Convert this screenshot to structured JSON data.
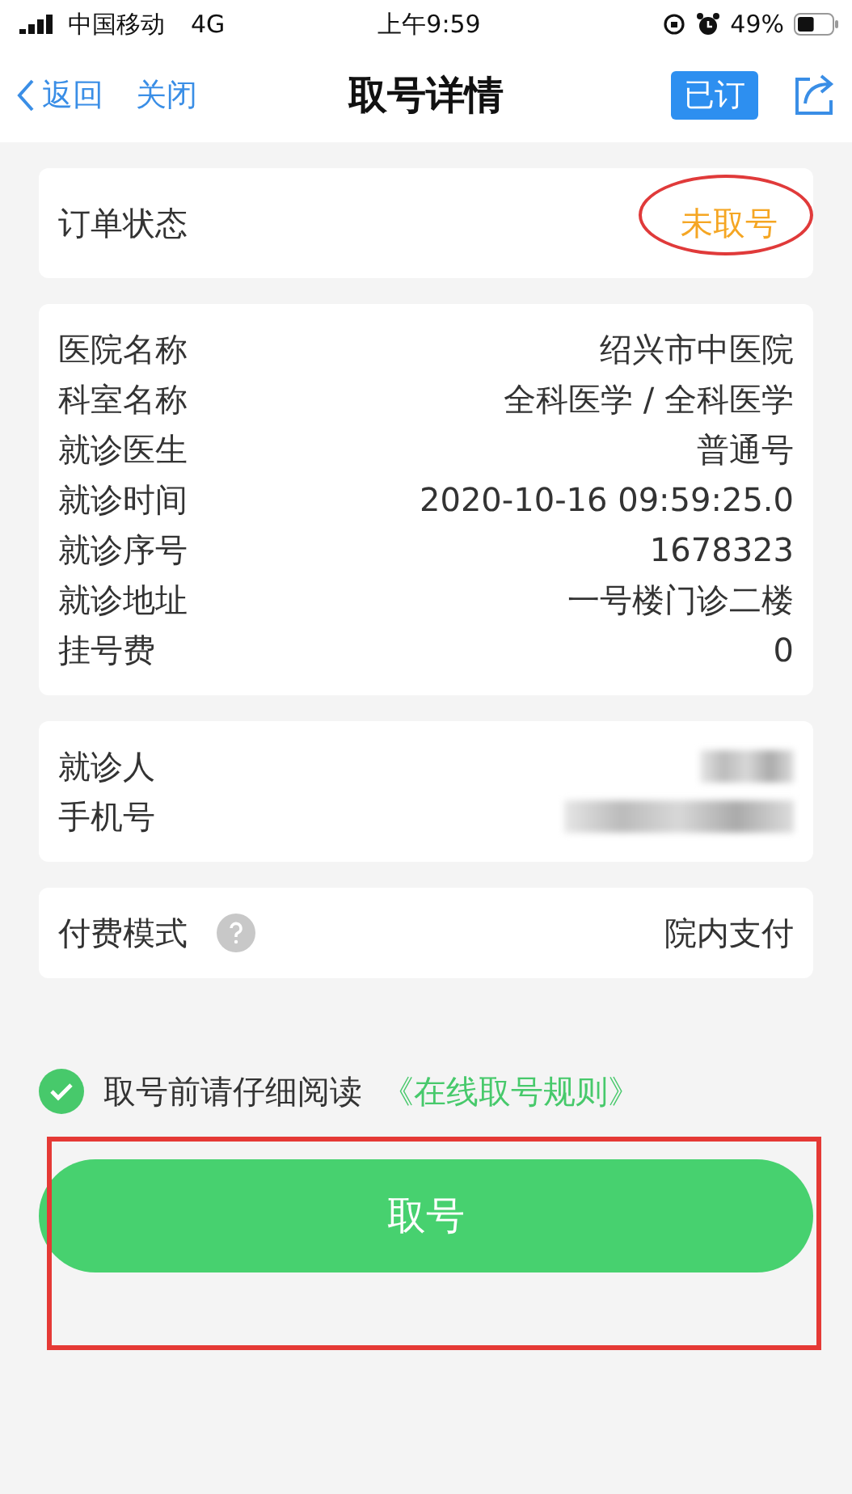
{
  "status_bar": {
    "carrier": "中国移动",
    "network": "4G",
    "time": "上午9:59",
    "battery": "49%"
  },
  "nav": {
    "back": "返回",
    "close": "关闭",
    "title": "取号详情",
    "badge": "已订"
  },
  "order_status": {
    "label": "订单状态",
    "value": "未取号",
    "circled": true
  },
  "details": [
    {
      "label": "医院名称",
      "value": "绍兴市中医院"
    },
    {
      "label": "科室名称",
      "value": "全科医学 / 全科医学"
    },
    {
      "label": "就诊医生",
      "value": "普通号"
    },
    {
      "label": "就诊时间",
      "value": "2020-10-16 09:59:25.0"
    },
    {
      "label": "就诊序号",
      "value": "1678323"
    },
    {
      "label": "就诊地址",
      "value": "一号楼门诊二楼"
    },
    {
      "label": "挂号费",
      "value": "0"
    }
  ],
  "patient": [
    {
      "label": "就诊人",
      "redacted": true
    },
    {
      "label": "手机号",
      "redacted": true
    }
  ],
  "payment": {
    "label": "付费模式",
    "value": "院内支付"
  },
  "agreement": {
    "checked": true,
    "text": "取号前请仔细阅读",
    "link": "《在线取号规则》"
  },
  "action": {
    "label": "取号",
    "framed": true
  }
}
